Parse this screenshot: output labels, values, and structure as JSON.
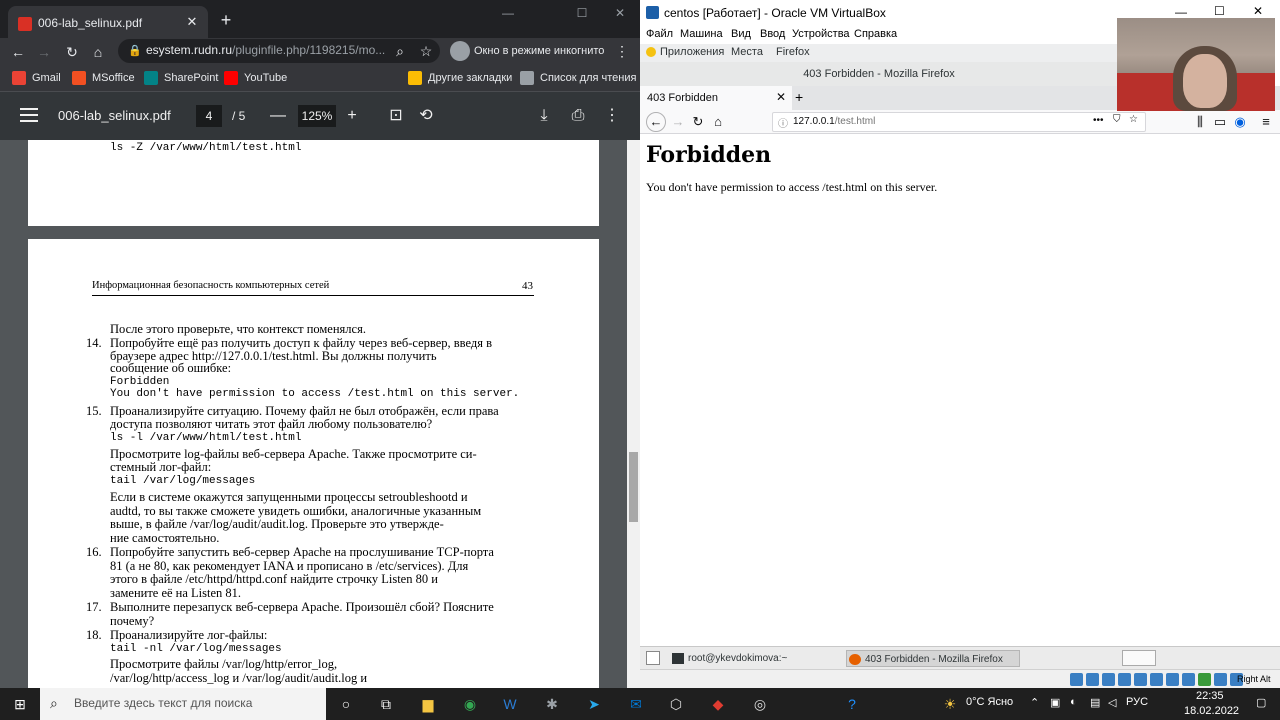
{
  "chrome": {
    "tab_title": "006-lab_selinux.pdf",
    "url_host": "esystem.rudn.ru",
    "url_path": "/pluginfile.php/1198215/mo...",
    "incognito_label": "Окно в режиме инкогнито",
    "bookmarks": [
      {
        "label": "Gmail",
        "color": "#ea4335"
      },
      {
        "label": "MSoffice",
        "color": "#f25022"
      },
      {
        "label": "SharePoint",
        "color": "#038387"
      },
      {
        "label": "YouTube",
        "color": "#ff0000"
      }
    ],
    "bookmarks_right": [
      {
        "label": "Другие закладки",
        "color": "#fbbc04"
      },
      {
        "label": "Список для чтения",
        "color": "#9aa0a6"
      }
    ]
  },
  "pdf": {
    "filename": "006-lab_selinux.pdf",
    "page_current": "4",
    "page_total": "/  5",
    "zoom": "125%",
    "prev_page_line": "ls -Z /var/www/html/test.html",
    "header_left": "Информационная безопасность компьютерных сетей",
    "header_right": "43",
    "lines": [
      {
        "t": "После этого проверьте, что контекст поменялся."
      },
      {
        "n": "14.",
        "t": "Попробуйте ещё раз получить доступ к файлу через веб-сервер, введя в"
      },
      {
        "t": "браузере адрес http://127.0.0.1/test.html. Вы должны получить"
      },
      {
        "t": "сообщение об ошибке:"
      },
      {
        "t": "Forbidden",
        "mono": true
      },
      {
        "t": "You don't have permission to access /test.html on this server.",
        "mono": true
      },
      {
        "n": "15.",
        "t": "Проанализируйте ситуацию. Почему файл не был отображён, если права"
      },
      {
        "t": "доступа позволяют читать этот файл любому пользователю?"
      },
      {
        "t": "ls -l /var/www/html/test.html",
        "mono": true
      },
      {
        "t": "Просмотрите log-файлы веб-сервера Apache. Также просмотрите си-"
      },
      {
        "t": "стемный лог-файл:"
      },
      {
        "t": "tail /var/log/messages",
        "mono": true
      },
      {
        "t": "Если в системе окажутся запущенными процессы setroubleshootd и"
      },
      {
        "t": "audtd, то вы также сможете увидеть ошибки, аналогичные указанным"
      },
      {
        "t": "выше, в файле /var/log/audit/audit.log. Проверьте это утвержде-"
      },
      {
        "t": "ние самостоятельно."
      },
      {
        "n": "16.",
        "t": "Попробуйте запустить веб-сервер Apache на прослушивание TCP-порта"
      },
      {
        "t": "81 (а не 80, как рекомендует IANA и прописано в /etc/services). Для"
      },
      {
        "t": "этого в файле /etc/httpd/httpd.conf найдите строчку Listen 80 и"
      },
      {
        "t": "замените её на Listen 81."
      },
      {
        "n": "17.",
        "t": "Выполните перезапуск веб-сервера Apache. Произошёл сбой? Поясните"
      },
      {
        "t": "почему?"
      },
      {
        "n": "18.",
        "t": "Проанализируйте лог-файлы:"
      },
      {
        "t": "tail -nl /var/log/messages",
        "mono": true
      },
      {
        "t": "Просмотрите          файлы          /var/log/http/error_log,"
      },
      {
        "t": "/var/log/http/access_log   и   /var/log/audit/audit.log   и"
      }
    ]
  },
  "vbox": {
    "title": "centos [Работает] - Oracle VM VirtualBox",
    "menu": [
      "Файл",
      "Машина",
      "Вид",
      "Ввод",
      "Устройства",
      "Справка"
    ],
    "gnome_menu": [
      "Приложения",
      "Места",
      "Firefox"
    ],
    "ff_window_title": "403 Forbidden - Mozilla Firefox",
    "ff_tab": "403 Forbidden",
    "ff_url_host": "127.0.0.1",
    "ff_url_path": "/test.html",
    "page_heading": "Forbidden",
    "page_text": "You don't have permission to access /test.html on this server.",
    "tasks": [
      "root@ykevdokimova:~",
      "403 Forbidden - Mozilla Firefox"
    ],
    "host_key": "Right Alt"
  },
  "taskbar": {
    "search_placeholder": "Введите здесь текст для поиска",
    "weather": "0°C Ясно",
    "lang": "РУС",
    "time": "22:35",
    "date": "18.02.2022"
  }
}
